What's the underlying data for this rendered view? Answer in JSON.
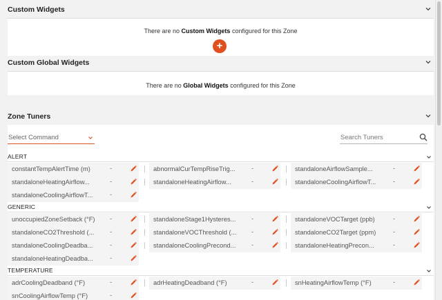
{
  "custom_widgets": {
    "title": "Custom Widgets",
    "msg_pre": "There are no ",
    "msg_bold": "Custom Widgets",
    "msg_post": " configured for this Zone",
    "add_label": "+"
  },
  "custom_global_widgets": {
    "title": "Custom Global Widgets",
    "msg_pre": "There are no ",
    "msg_bold": "Global Widgets",
    "msg_post": " configured for this Zone"
  },
  "zone_tuners": {
    "title": "Zone Tuners",
    "select_command": "Select Command",
    "search_placeholder": "Search Tuners",
    "groups": [
      {
        "label": "ALERT",
        "rows": [
          [
            {
              "name": "constantTempAlertTime (m)",
              "value": "-"
            },
            {
              "name": "abnormalCurTempRiseTrig...",
              "value": "-"
            },
            {
              "name": "standaloneAirflowSample...",
              "value": "-"
            }
          ],
          [
            {
              "name": "standaloneHeatingAirflow...",
              "value": "-"
            },
            {
              "name": "standaloneHeatingAirflow...",
              "value": "-"
            },
            {
              "name": "standaloneCoolingAirflowT...",
              "value": "-"
            }
          ],
          [
            {
              "name": "standaloneCoolingAirflowT...",
              "value": "-"
            }
          ]
        ]
      },
      {
        "label": "GENERIC",
        "rows": [
          [
            {
              "name": "unoccupiedZoneSetback (°F)",
              "value": "-"
            },
            {
              "name": "standaloneStage1Hysteres...",
              "value": "-"
            },
            {
              "name": "standaloneVOCTarget (ppb)",
              "value": "-"
            }
          ],
          [
            {
              "name": "standaloneCO2Threshold (...",
              "value": "-"
            },
            {
              "name": "standaloneVOCThreshold (...",
              "value": "-"
            },
            {
              "name": "standaloneCO2Target (ppm)",
              "value": "-"
            }
          ],
          [
            {
              "name": "standaloneCoolingDeadba...",
              "value": "-"
            },
            {
              "name": "standaloneCoolingPrecond...",
              "value": "-"
            },
            {
              "name": "standaloneHeatingPrecon...",
              "value": "-"
            }
          ],
          [
            {
              "name": "standaloneHeatingDeadba...",
              "value": "-"
            }
          ]
        ]
      },
      {
        "label": "TEMPERATURE",
        "rows": [
          [
            {
              "name": "adrCoolingDeadband (°F)",
              "value": "-"
            },
            {
              "name": "adrHeatingDeadband (°F)",
              "value": "-"
            },
            {
              "name": "snHeatingAirflowTemp (°F)",
              "value": "-"
            }
          ],
          [
            {
              "name": "snCoolingAirflowTemp (°F)",
              "value": "-"
            }
          ]
        ]
      }
    ]
  },
  "colors": {
    "accent": "#e24f1e",
    "edit_icon": "#e24f1e"
  },
  "icons": {
    "section_toggle": "chevron-down-icon",
    "edit": "pencil-icon",
    "search": "search-icon",
    "add": "plus-icon"
  }
}
